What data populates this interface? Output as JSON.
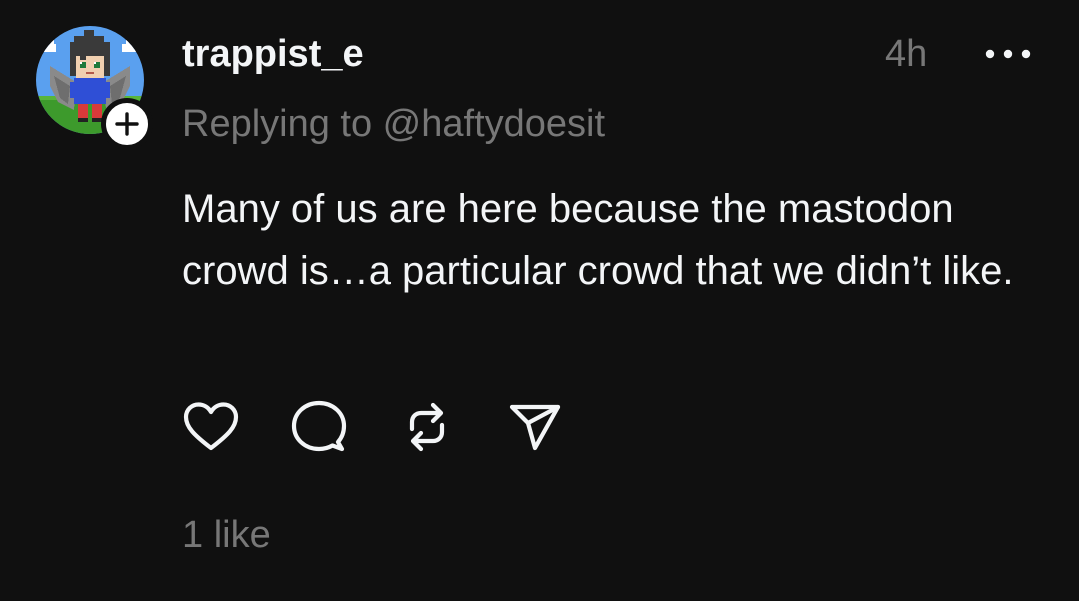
{
  "post": {
    "author": "trappist_e",
    "time": "4h",
    "reply_prefix": "Replying to ",
    "reply_handle": "@haftydoesit",
    "text": "Many of us are here because the mastodon crowd is…a particular crowd that we didn’t like.",
    "likes": "1 like"
  },
  "icons": {
    "follow": "plus-icon",
    "more": "more-horizontal-icon",
    "like": "heart-icon",
    "reply": "comment-icon",
    "repost": "repost-icon",
    "share": "send-icon"
  },
  "colors": {
    "background": "#101010",
    "primary_text": "#f3f5f7",
    "secondary_text": "#777777"
  }
}
